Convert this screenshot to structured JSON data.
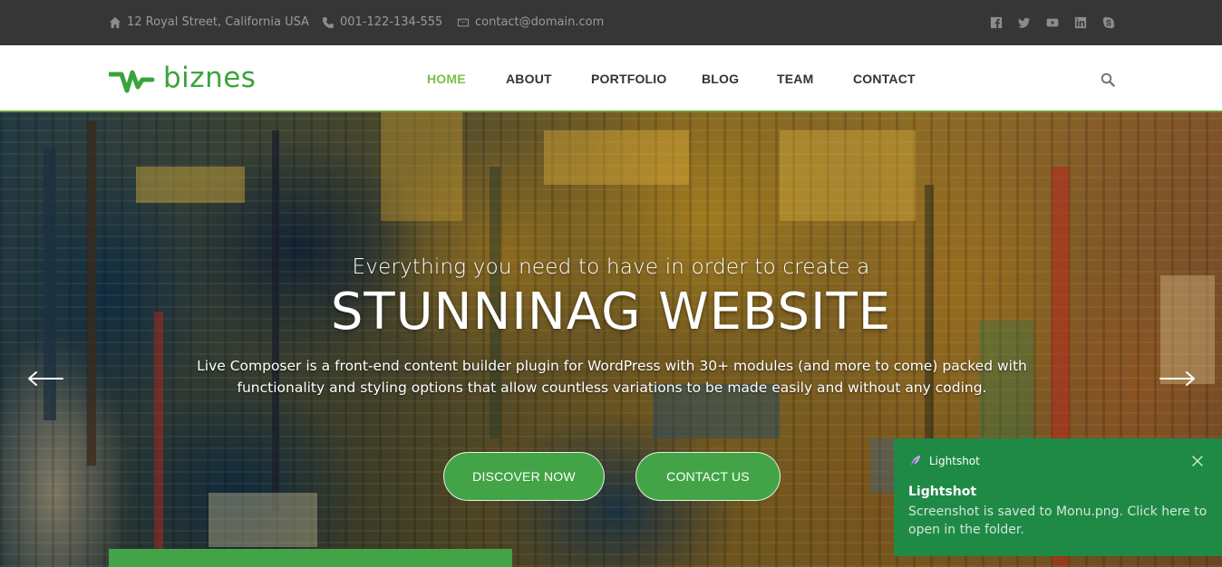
{
  "topbar": {
    "address": "12 Royal Street, California USA",
    "phone": "001-122-134-555",
    "email": "contact@domain.com",
    "social_icons": [
      "facebook-icon",
      "twitter-icon",
      "youtube-icon",
      "linkedin-icon",
      "skype-icon"
    ]
  },
  "nav": {
    "logo_text": "biznes",
    "items": [
      {
        "label": "HOME",
        "active": true
      },
      {
        "label": "ABOUT",
        "active": false
      },
      {
        "label": "PORTFOLIO",
        "active": false
      },
      {
        "label": "BLOG",
        "active": false
      },
      {
        "label": "TEAM",
        "active": false
      },
      {
        "label": "CONTACT",
        "active": false
      }
    ],
    "search_icon": "search-icon"
  },
  "hero": {
    "subtitle": "Everything you need to have in order to create a",
    "title": "STUNNINAG WEBSITE",
    "description": "Live Composer is a front-end content builder plugin for WordPress with 30+ modules (and more to come) packed with functionality and styling options that allow countless variations to be made easily and without any coding.",
    "buttons": {
      "discover": "DISCOVER NOW",
      "contact": "CONTACT US"
    }
  },
  "toast": {
    "app": "Lightshot",
    "title": "Lightshot",
    "message": "Screenshot is saved to Monu.png. Click here to open in the folder."
  },
  "colors": {
    "brand_green": "#43a447",
    "nav_active": "#7cbf4a",
    "topbar_bg": "#363636",
    "toast_bg": "#1f8a46"
  }
}
